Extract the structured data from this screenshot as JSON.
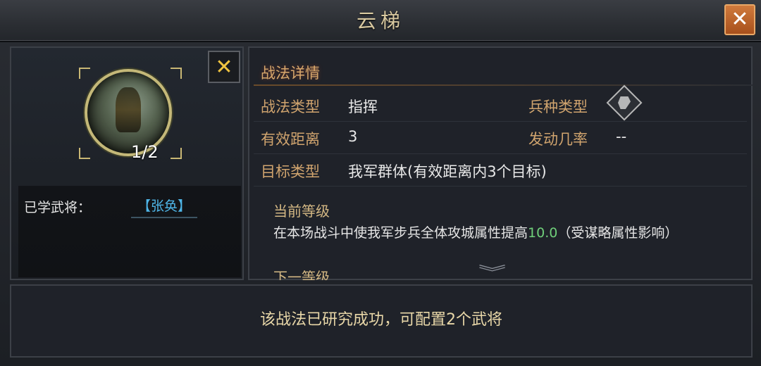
{
  "window": {
    "title": "云梯",
    "close_icon": "close-icon"
  },
  "left_panel": {
    "close_icon": "close-icon",
    "skill_icon": "general-portrait-icon",
    "skill_count": "1/2",
    "learned_label": "已学武将：",
    "learned_general": "【张奂】"
  },
  "details": {
    "section_title": "战法详情",
    "type_label": "战法类型",
    "type_value": "指挥",
    "troop_label": "兵种类型",
    "troop_icon": "infantry-shield-icon",
    "range_label": "有效距离",
    "range_value": "3",
    "rate_label": "发动几率",
    "rate_value": "--",
    "target_label": "目标类型",
    "target_value": "我军群体(有效距离内3个目标)",
    "current_level_title": "当前等级",
    "desc_before": "在本场战斗中使我军步兵全体攻城属性提高",
    "desc_value": "10.0",
    "desc_after": "（受谋略属性影响）",
    "next_level_title": "下一等级",
    "more_icon": "chevron-down-icon"
  },
  "footer": {
    "message": "该战法已研究成功，可配置2个武将"
  },
  "colors": {
    "label_gold": "#d0a46e",
    "highlight_green": "#6fcf7a",
    "general_blue": "#4fb6e8",
    "close_orange": "#c0662a"
  }
}
